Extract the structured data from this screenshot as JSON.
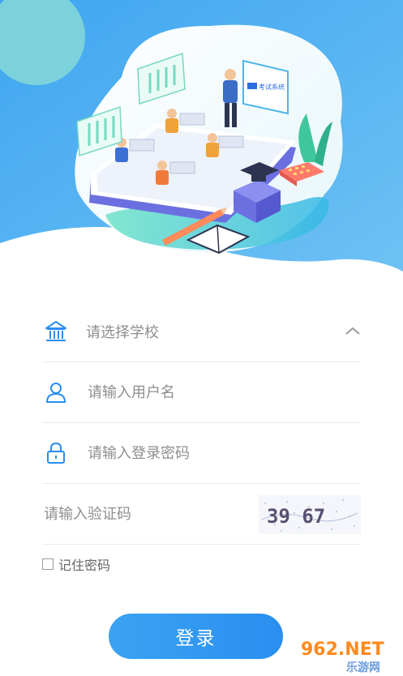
{
  "form": {
    "school": {
      "placeholder": "请选择学校"
    },
    "username": {
      "placeholder": "请输入用户名"
    },
    "password": {
      "placeholder": "请输入登录密码"
    },
    "captcha": {
      "placeholder": "请输入验证码",
      "code": "39 67"
    }
  },
  "remember": {
    "label": "记住密码"
  },
  "login": {
    "label": "登录"
  },
  "watermark": {
    "line1": "962.NET",
    "line2": "乐游网"
  },
  "screen_label": {
    "text": "考试系统"
  },
  "colors": {
    "accent": "#2a8ef0",
    "hero_blue": "#5fb3f1",
    "teal": "#43d3c6"
  }
}
